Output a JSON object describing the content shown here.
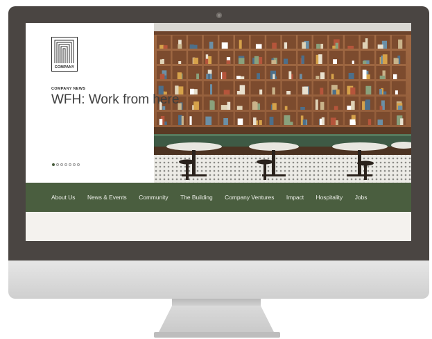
{
  "site": {
    "logo_text": "COMPANY",
    "hero": {
      "kicker": "COMPANY NEWS",
      "headline": "WFH: Work from here",
      "slide_count": 7,
      "active_slide": 1
    },
    "nav": {
      "items": [
        {
          "label": "About Us"
        },
        {
          "label": "News & Events"
        },
        {
          "label": "Community"
        },
        {
          "label": "The Building"
        },
        {
          "label": "Company Ventures"
        },
        {
          "label": "Impact"
        },
        {
          "label": "Hospitality"
        },
        {
          "label": "Jobs"
        }
      ]
    }
  },
  "colors": {
    "nav_bg": "#4a5e3f",
    "bezel": "#4a4542",
    "page_bg": "#f4f2ee"
  }
}
